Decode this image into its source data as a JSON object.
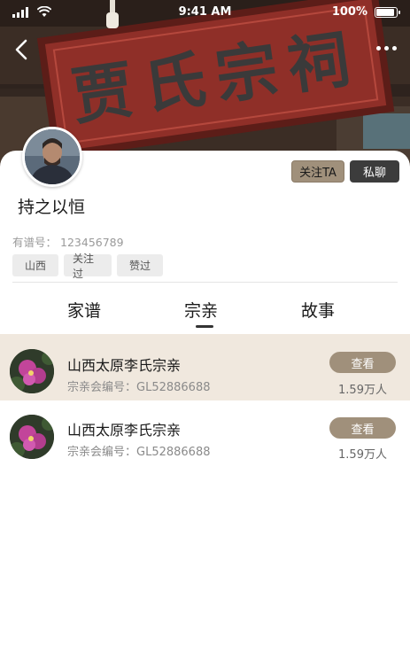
{
  "status_bar": {
    "time": "9:41 AM",
    "battery": "100%"
  },
  "hero": {
    "plaque_text": "贾氏宗祠"
  },
  "header": {
    "back_icon": "chevron-left-icon",
    "more_icon": "more-dots-icon"
  },
  "profile": {
    "name": "持之以恒",
    "reg_label": "有谱号：",
    "reg_number": "123456789",
    "follow_label": "关注TA",
    "chat_label": "私聊",
    "tags": [
      "山西",
      "关注过",
      "赞过"
    ]
  },
  "tabs": [
    {
      "label": "家谱",
      "active": false
    },
    {
      "label": "宗亲",
      "active": true
    },
    {
      "label": "故事",
      "active": false
    }
  ],
  "list": [
    {
      "title": "山西太原李氏宗亲",
      "code_label": "宗亲会编号：",
      "code": "GL52886688",
      "button": "查看",
      "count": "1.59万人",
      "highlighted": true
    },
    {
      "title": "山西太原李氏宗亲",
      "code_label": "宗亲会编号：",
      "code": "GL52886688",
      "button": "查看",
      "count": "1.59万人",
      "highlighted": false
    }
  ],
  "colors": {
    "accent": "#a0907b",
    "dark_button": "#3c3c3c",
    "highlight_row": "#f0e8de",
    "plaque_red": "#8f2f28"
  }
}
